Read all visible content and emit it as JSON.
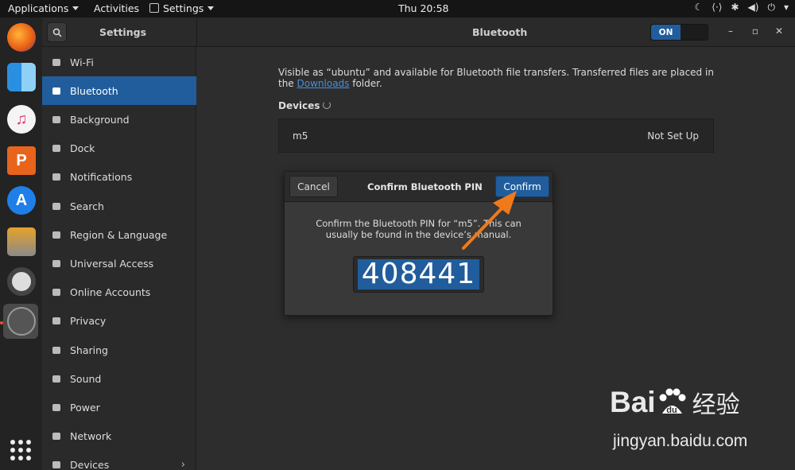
{
  "topbar": {
    "applications": "Applications",
    "activities": "Activities",
    "settings_menu": "Settings",
    "clock": "Thu 20:58"
  },
  "dock": {
    "apps": [
      "firefox",
      "finder",
      "itunes",
      "wps-presentation",
      "app-store",
      "software-updater",
      "help",
      "system-settings"
    ],
    "show_apps": "show-applications-icon"
  },
  "window": {
    "sidebar_title": "Settings",
    "title": "Bluetooth",
    "bluetooth_switch": "ON",
    "sidebar": [
      {
        "label": "Wi-Fi",
        "icon": "wifi-icon"
      },
      {
        "label": "Bluetooth",
        "icon": "bluetooth-icon",
        "selected": true
      },
      {
        "label": "Background",
        "icon": "background-icon"
      },
      {
        "label": "Dock",
        "icon": "dock-icon"
      },
      {
        "label": "Notifications",
        "icon": "bell-icon"
      },
      {
        "label": "Search",
        "icon": "search-icon"
      },
      {
        "label": "Region & Language",
        "icon": "camera-icon"
      },
      {
        "label": "Universal Access",
        "icon": "accessibility-icon"
      },
      {
        "label": "Online Accounts",
        "icon": "online-accounts-icon"
      },
      {
        "label": "Privacy",
        "icon": "hand-icon"
      },
      {
        "label": "Sharing",
        "icon": "share-icon"
      },
      {
        "label": "Sound",
        "icon": "speaker-icon"
      },
      {
        "label": "Power",
        "icon": "power-icon"
      },
      {
        "label": "Network",
        "icon": "network-icon"
      },
      {
        "label": "Devices",
        "icon": "devices-icon"
      }
    ]
  },
  "bluetooth": {
    "desc_before": "Visible as “ubuntu” and available for Bluetooth file transfers. Transferred files are placed in the ",
    "desc_link": "Downloads",
    "desc_after": " folder.",
    "devices_heading": "Devices",
    "device": {
      "name": "m5",
      "status": "Not Set Up"
    }
  },
  "dialog": {
    "cancel": "Cancel",
    "title": "Confirm Bluetooth PIN",
    "confirm": "Confirm",
    "message": "Confirm the Bluetooth PIN for “m5”. This can usually be found in the device’s manual.",
    "pin": "408441"
  },
  "watermark": {
    "brand": "Bai",
    "brand_cn": "经验",
    "url": "jingyan.baidu.com"
  },
  "colors": {
    "accent": "#215d9c",
    "arrow": "#f07a1a"
  }
}
